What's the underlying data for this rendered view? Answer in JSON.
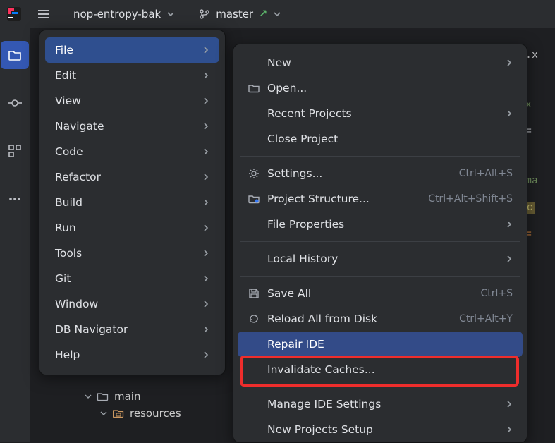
{
  "topbar": {
    "project": "nop-entropy-bak",
    "branch": "master"
  },
  "mainMenu": [
    {
      "label": "File",
      "hasSub": true,
      "selected": true
    },
    {
      "label": "Edit",
      "hasSub": true
    },
    {
      "label": "View",
      "hasSub": true
    },
    {
      "label": "Navigate",
      "hasSub": true
    },
    {
      "label": "Code",
      "hasSub": true
    },
    {
      "label": "Refactor",
      "hasSub": true
    },
    {
      "label": "Build",
      "hasSub": true
    },
    {
      "label": "Run",
      "hasSub": true
    },
    {
      "label": "Tools",
      "hasSub": true
    },
    {
      "label": "Git",
      "hasSub": true
    },
    {
      "label": "Window",
      "hasSub": true
    },
    {
      "label": "DB Navigator",
      "hasSub": true
    },
    {
      "label": "Help",
      "hasSub": true
    }
  ],
  "fileMenu": [
    {
      "label": "New",
      "hasSub": true
    },
    {
      "label": "Open...",
      "icon": "folder"
    },
    {
      "label": "Recent Projects",
      "hasSub": true
    },
    {
      "label": "Close Project"
    },
    {
      "sep": true
    },
    {
      "label": "Settings...",
      "icon": "gear",
      "shortcut": "Ctrl+Alt+S"
    },
    {
      "label": "Project Structure...",
      "icon": "struct",
      "shortcut": "Ctrl+Alt+Shift+S"
    },
    {
      "label": "File Properties",
      "hasSub": true
    },
    {
      "sep": true
    },
    {
      "label": "Local History",
      "hasSub": true
    },
    {
      "sep": true
    },
    {
      "label": "Save All",
      "icon": "save",
      "shortcut": "Ctrl+S"
    },
    {
      "label": "Reload All from Disk",
      "icon": "reload",
      "shortcut": "Ctrl+Alt+Y"
    },
    {
      "label": "Repair IDE",
      "hovered": true
    },
    {
      "label": "Invalidate Caches...",
      "boxed": true
    },
    {
      "sep": true
    },
    {
      "label": "Manage IDE Settings",
      "hasSub": true
    },
    {
      "label": "New Projects Setup",
      "hasSub": true
    }
  ],
  "tree": {
    "main": "main",
    "resources": "resources"
  },
  "editorFragments": {
    "l1": "th.x",
    "l2": "=\"x",
    "l3": "ds=",
    "l4": "=\"ma",
    "l5": "urc",
    "l6": "ch="
  }
}
